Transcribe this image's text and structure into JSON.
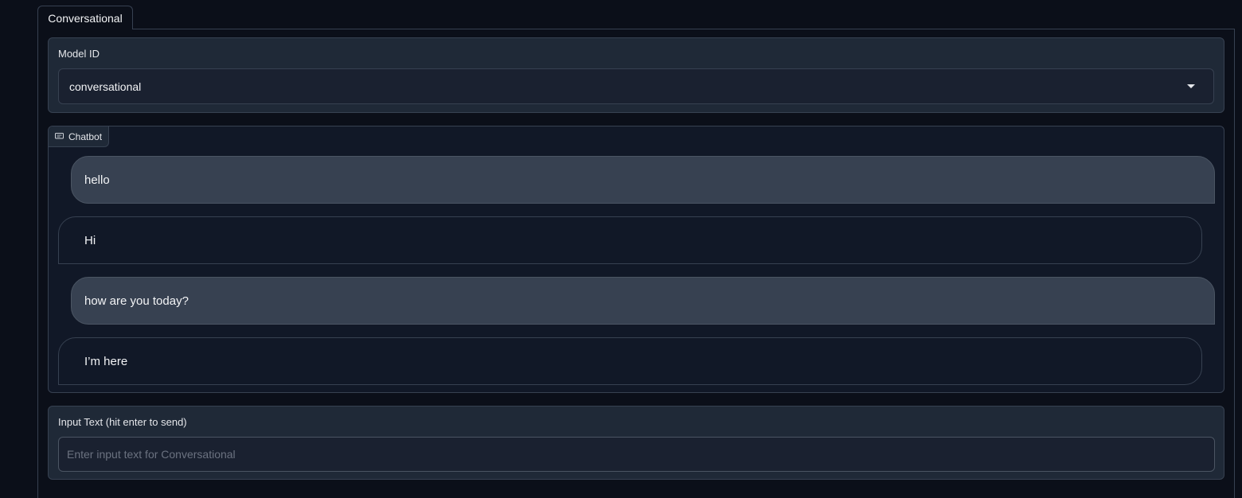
{
  "tabs": [
    {
      "label": "Conversational",
      "active": true
    }
  ],
  "model": {
    "label": "Model ID",
    "selected": "conversational"
  },
  "chatbot": {
    "label": "Chatbot",
    "icon": "chat-icon",
    "messages": [
      {
        "role": "user",
        "text": "hello"
      },
      {
        "role": "bot",
        "text": "Hi"
      },
      {
        "role": "user",
        "text": "how are you today?"
      },
      {
        "role": "bot",
        "text": "I’m here"
      }
    ]
  },
  "input": {
    "label": "Input Text (hit enter to send)",
    "placeholder": "Enter input text for Conversational",
    "value": ""
  },
  "colors": {
    "background": "#0b0f19",
    "block": "#1f2937",
    "user_bubble": "#374151",
    "bot_bubble": "#111827",
    "border": "#374151"
  }
}
